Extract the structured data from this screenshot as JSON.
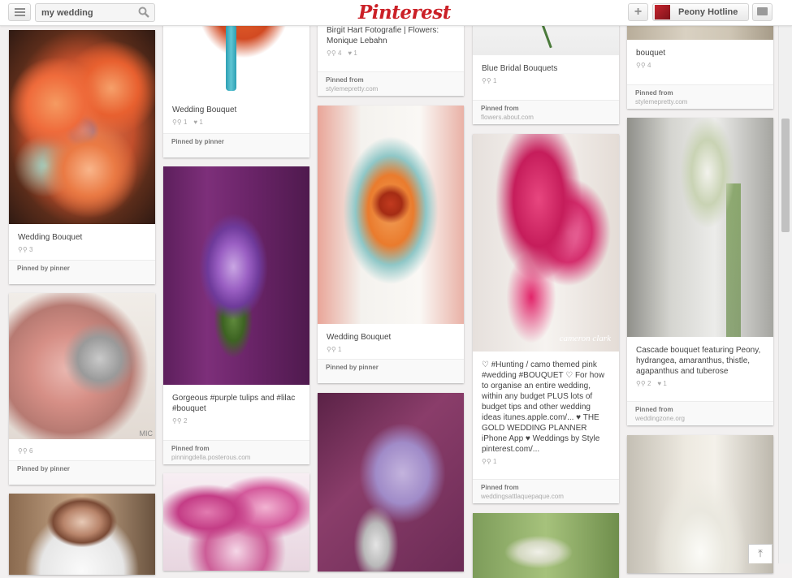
{
  "header": {
    "search_value": "my wedding",
    "logo": "Pinterest",
    "add_label": "+",
    "user_name": "Peony Hotline",
    "brand_color": "#cb2027"
  },
  "pins": [
    {
      "id": "c1a",
      "desc": "Wedding Bouquet",
      "stats": [
        "3"
      ],
      "foot1": "Pinned by pinner",
      "foot2": ""
    },
    {
      "id": "c1b",
      "desc": "",
      "stats": [
        "6"
      ],
      "foot1": "Pinned by pinner",
      "foot2": ""
    },
    {
      "id": "c2a",
      "desc": "Wedding Bouquet",
      "stats": [
        "1",
        "1"
      ],
      "foot1": "Pinned by pinner",
      "foot2": ""
    },
    {
      "id": "c2b",
      "desc": "Gorgeous #purple tulips and #lilac #bouquet",
      "stats": [
        "2"
      ],
      "foot1": "Pinned from",
      "foot2": "pinningdella.posterous.com"
    },
    {
      "id": "c3a",
      "desc": "Birgit Hart Fotografie | Flowers: Monique Lebahn",
      "stats": [
        "4",
        "1"
      ],
      "foot1": "Pinned from",
      "foot2": "stylemepretty.com"
    },
    {
      "id": "c3b",
      "desc": "Wedding Bouquet",
      "stats": [
        "1"
      ],
      "foot1": "Pinned by pinner",
      "foot2": ""
    },
    {
      "id": "c4a",
      "desc": "Blue Bridal Bouquets",
      "stats": [
        "1"
      ],
      "foot1": "Pinned from",
      "foot2": "flowers.about.com"
    },
    {
      "id": "c4b",
      "desc": "♡ #Hunting / camo themed pink #wedding #BOUQUET ♡ For how to organise an entire wedding, within any budget PLUS lots of budget tips and other wedding ideas itunes.apple.com/... ♥ THE GOLD WEDDING PLANNER iPhone App ♥ Weddings by Style pinterest.com/...",
      "stats": [
        "1"
      ],
      "foot1": "Pinned from",
      "foot2": "weddingsattlaquepaque.com"
    },
    {
      "id": "c5a",
      "desc": "bouquet",
      "stats": [
        "4"
      ],
      "foot1": "Pinned from",
      "foot2": "stylemepretty.com"
    },
    {
      "id": "c5b",
      "desc": "Cascade bouquet featuring Peony, hydrangea, amaranthus, thistle, agapanthus and tuberose",
      "stats": [
        "2",
        "1"
      ],
      "foot1": "Pinned from",
      "foot2": "weddingzone.org"
    }
  ],
  "watermarks": {
    "c1b": "MIC",
    "c4b": "cameron clark"
  }
}
